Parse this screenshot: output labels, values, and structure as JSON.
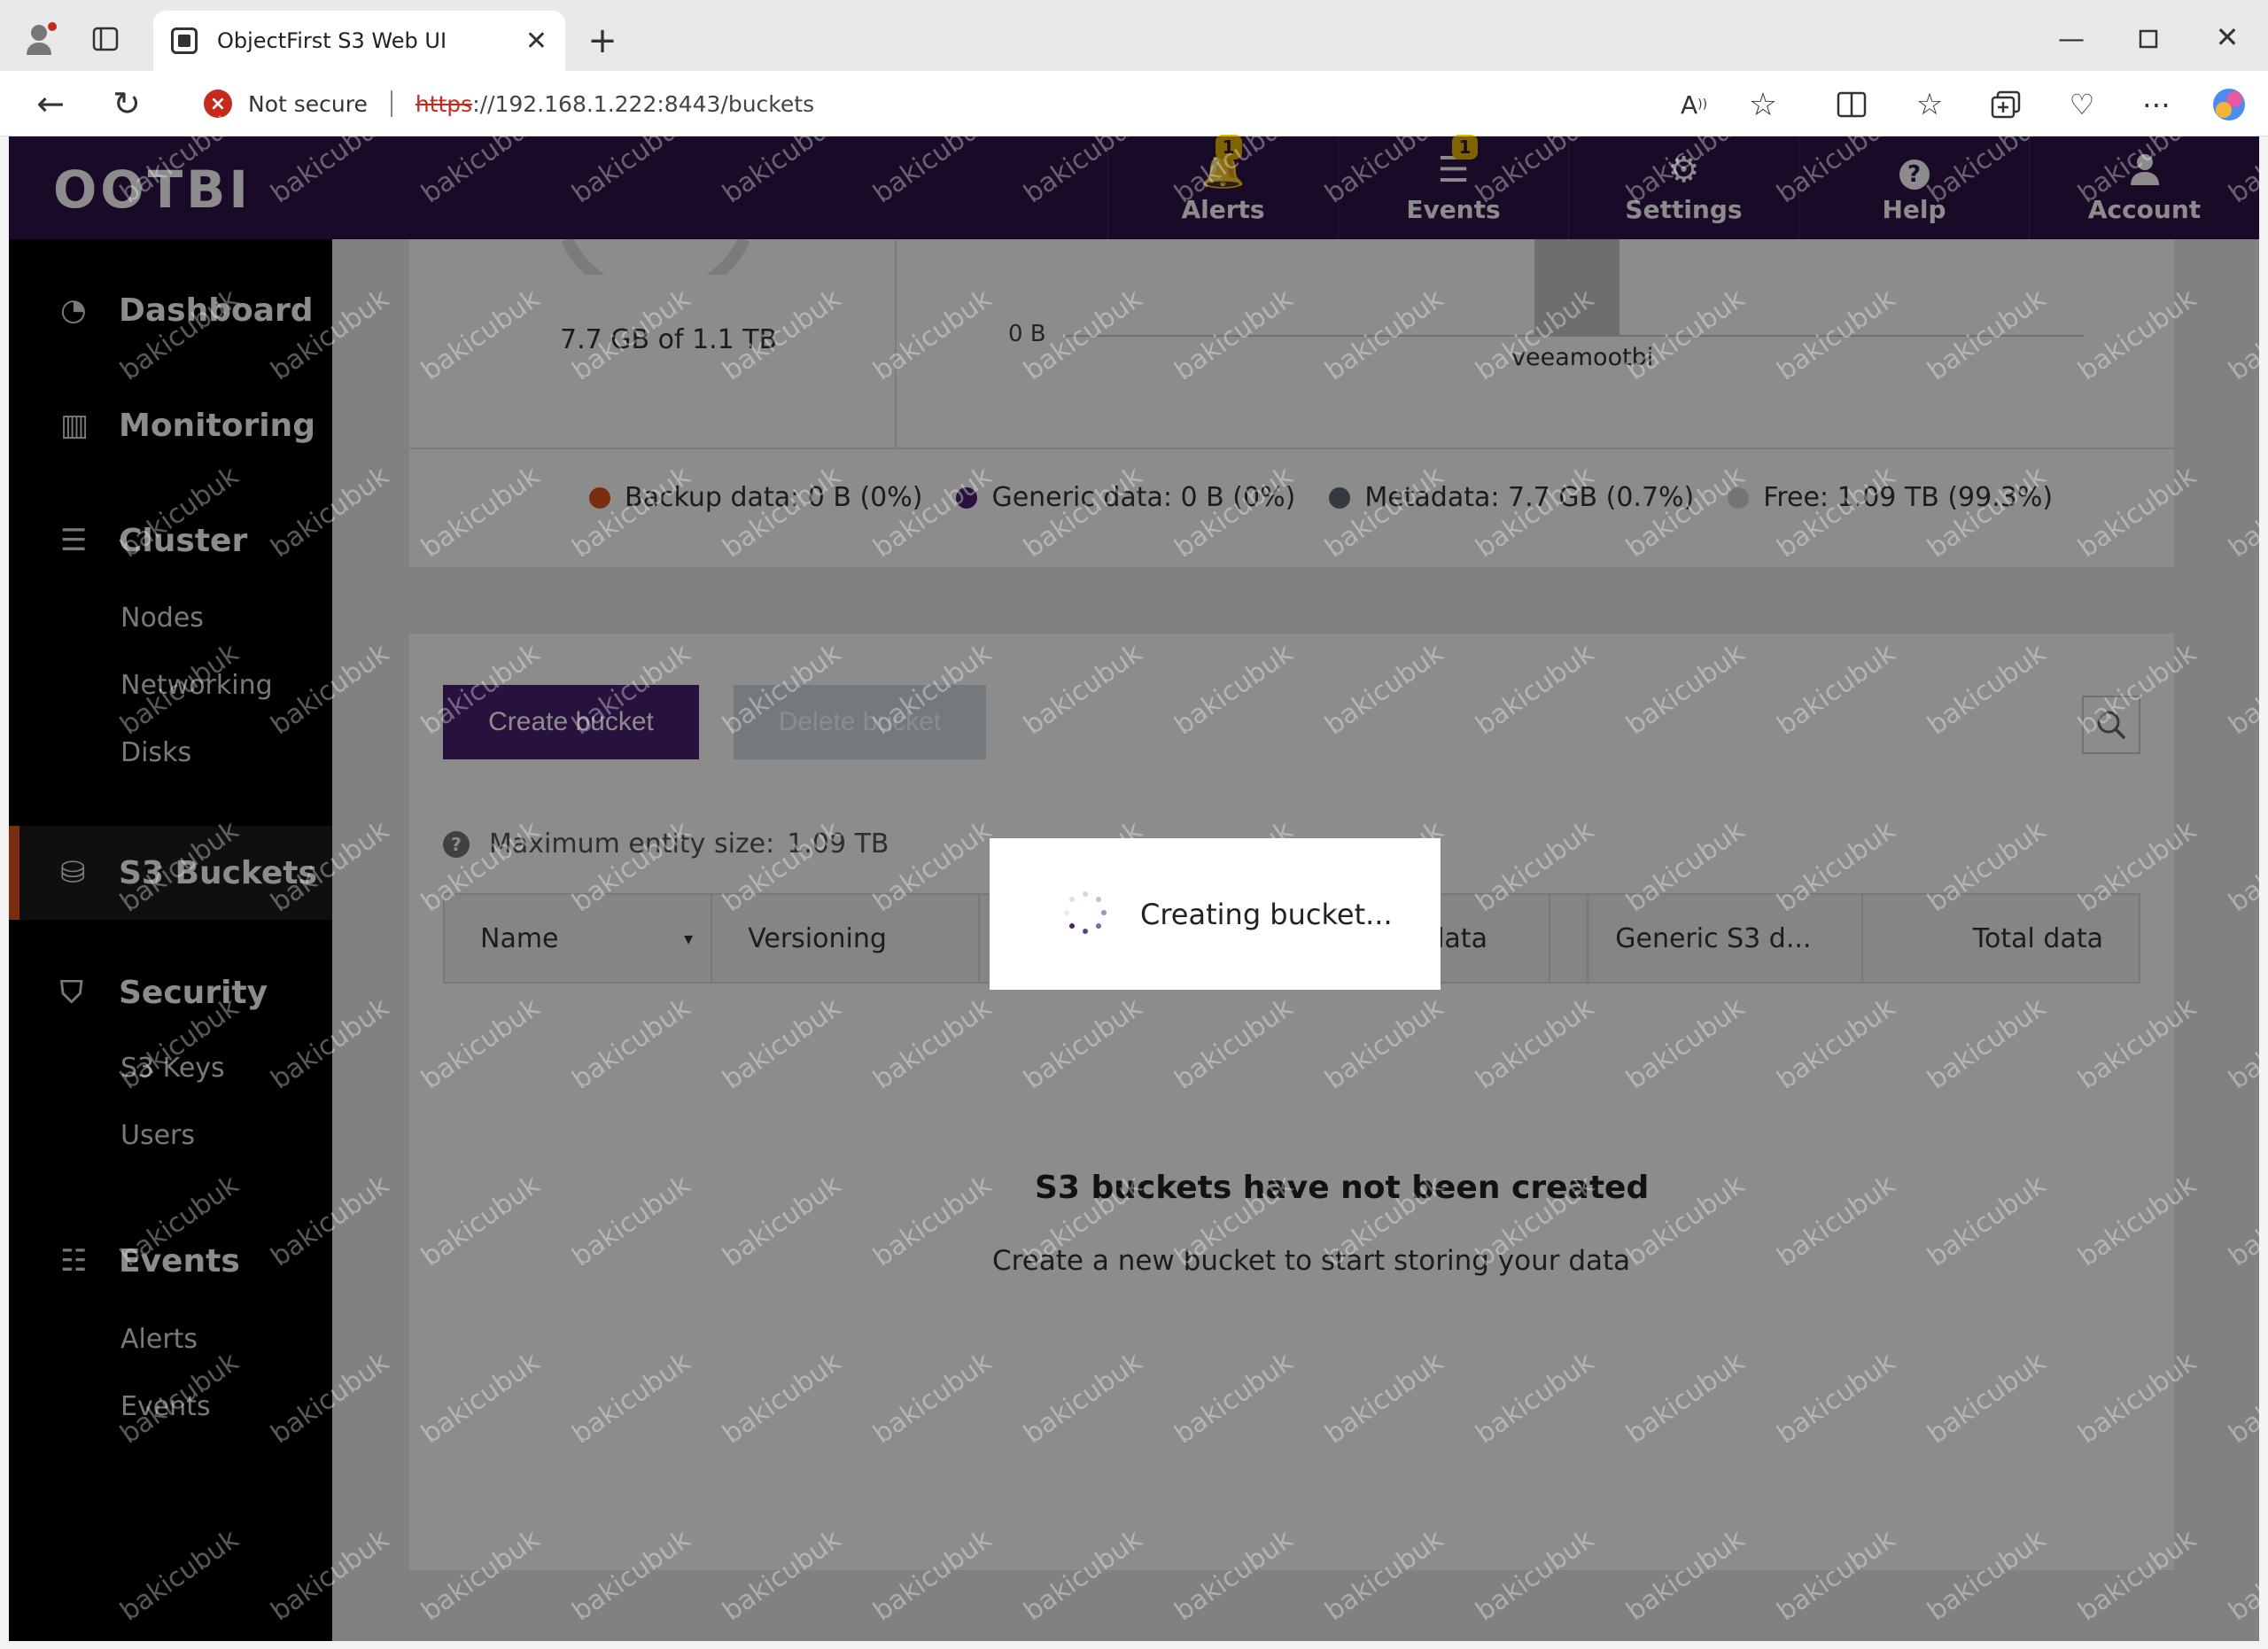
{
  "browser": {
    "tab_title": "ObjectFirst S3 Web UI",
    "security_label": "Not secure",
    "url_scheme": "https",
    "url_rest": "://192.168.1.222:8443/buckets"
  },
  "app": {
    "logo": "OOTBI",
    "nav": [
      {
        "label": "Alerts",
        "icon": "bell-icon",
        "badge": "1"
      },
      {
        "label": "Events",
        "icon": "list-icon",
        "badge": "1"
      },
      {
        "label": "Settings",
        "icon": "gear-icon"
      },
      {
        "label": "Help",
        "icon": "help-icon"
      },
      {
        "label": "Account",
        "icon": "user-icon"
      }
    ]
  },
  "sidebar": {
    "dashboard": "Dashboard",
    "monitoring": "Monitoring",
    "cluster": "Cluster",
    "cluster_items": [
      "Nodes",
      "Networking",
      "Disks"
    ],
    "s3_buckets": "S3 Buckets",
    "security": "Security",
    "security_items": [
      "S3 Keys",
      "Users"
    ],
    "events": "Events",
    "events_items": [
      "Alerts",
      "Events"
    ]
  },
  "stats": {
    "used": "7.7 GB of 1.1 TB",
    "axis_zero": "0 B",
    "bar_label": "veeamootbi",
    "legend": [
      {
        "label": "Backup data: 0 B (0%)",
        "color": "#e0531c"
      },
      {
        "label": "Generic data: 0 B (0%)",
        "color": "#4b1f72"
      },
      {
        "label": "Metadata: 7.7 GB (0.7%)",
        "color": "#5f6b73"
      },
      {
        "label": "Free: 1.09 TB (99.3%)",
        "color": "#d6d6d6"
      }
    ]
  },
  "buckets": {
    "create_label": "Create bucket",
    "delete_label": "Delete bucket",
    "max_size_label": "Maximum entity size:",
    "max_size_value": "1.09 TB",
    "columns": [
      "Name",
      "Versioning",
      "",
      "",
      "o data",
      "Generic S3 d...",
      "Total data"
    ],
    "empty_title": "S3 buckets have not been created",
    "empty_subtitle": "Create a new bucket to start storing your data"
  },
  "modal": {
    "message": "Creating bucket..."
  },
  "watermark": "bakicubuk",
  "colors": {
    "header": "#2e1547",
    "accent": "#4b1f72",
    "active_marker": "#e0531c"
  }
}
